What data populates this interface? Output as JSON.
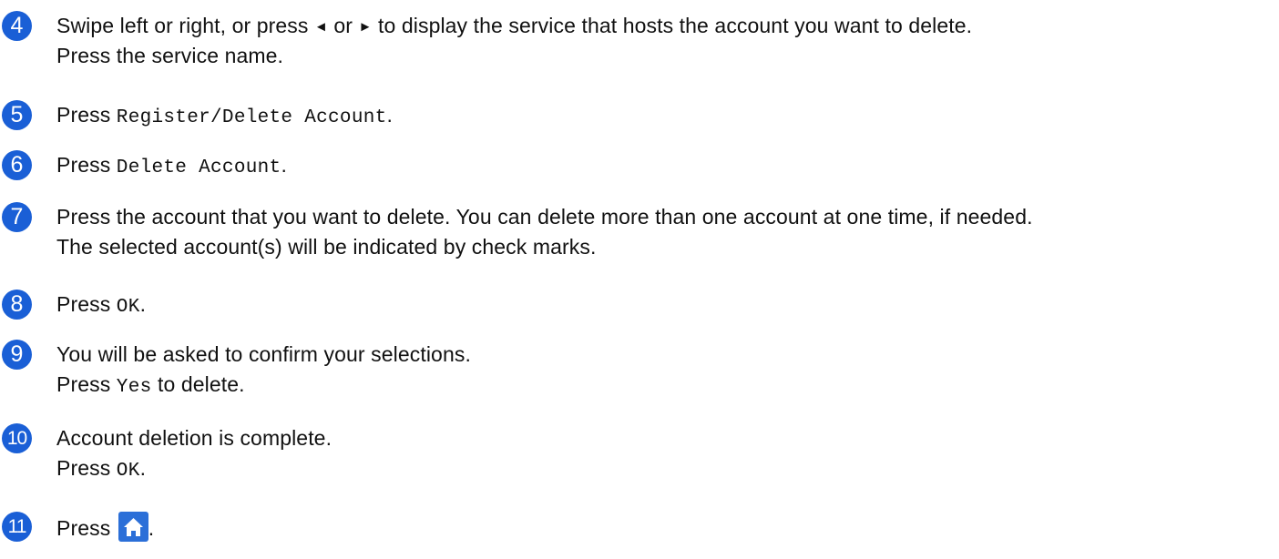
{
  "colors": {
    "step_badge": "#1a5fd6",
    "text": "#111111"
  },
  "steps": [
    {
      "num": "4",
      "seg": [
        "Swipe left or right, or press ",
        "◄",
        " or ",
        "►",
        " to display the service that hosts the account you want to delete."
      ],
      "line2": "Press the service name."
    },
    {
      "num": "5",
      "seg": [
        "Press ",
        "Register/Delete Account",
        "."
      ]
    },
    {
      "num": "6",
      "seg": [
        "Press ",
        "Delete Account",
        "."
      ]
    },
    {
      "num": "7",
      "line1": "Press the account that you want to delete. You can delete more than one account at one time, if needed.",
      "line2": "The selected account(s) will be indicated by check marks."
    },
    {
      "num": "8",
      "seg": [
        "Press ",
        "OK",
        "."
      ]
    },
    {
      "num": "9",
      "line1": "You will be asked to confirm your selections.",
      "seg2": [
        "Press ",
        "Yes",
        " to delete."
      ]
    },
    {
      "num": "10",
      "line1": "Account deletion is complete.",
      "seg2": [
        "Press ",
        "OK",
        "."
      ]
    },
    {
      "num": "11",
      "seg": [
        "Press ",
        "."
      ],
      "icon": "home-icon"
    }
  ]
}
